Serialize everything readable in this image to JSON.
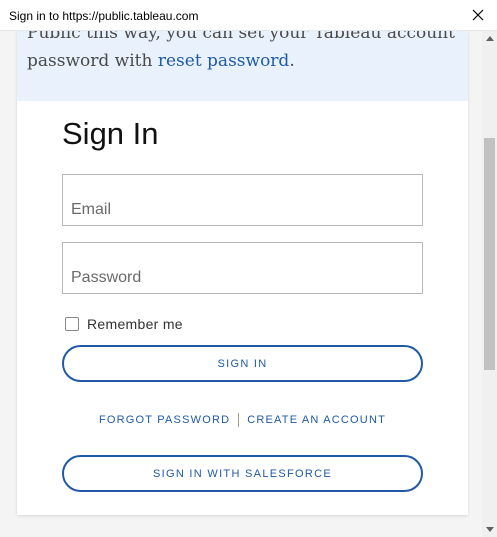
{
  "window": {
    "title": "Sign in to https://public.tableau.com"
  },
  "banner": {
    "line1": "Public this way, you can set your Tableau account",
    "line2_prefix": "password with ",
    "line2_link": "reset password",
    "line2_suffix": "."
  },
  "signin": {
    "heading": "Sign In",
    "email_placeholder": "Email",
    "password_placeholder": "Password",
    "remember_label": "Remember me",
    "signin_button": "SIGN IN",
    "forgot_link": "FORGOT PASSWORD",
    "create_link": "CREATE AN ACCOUNT",
    "salesforce_button": "SIGN IN WITH SALESFORCE"
  },
  "colors": {
    "accent": "#1f5aa6",
    "banner_bg": "#e9f2fc"
  }
}
